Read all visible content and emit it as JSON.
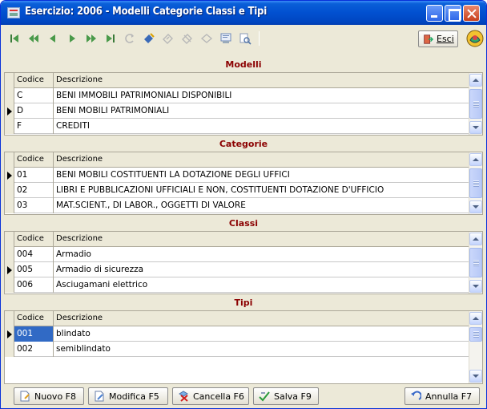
{
  "window": {
    "title": "Esercizio: 2006 - Modelli Categorie Classi e Tipi"
  },
  "toolbar": {
    "esci_label": "Esci"
  },
  "sections": {
    "modelli": {
      "title": "Modelli",
      "columns": [
        "Codice",
        "Descrizione"
      ],
      "rows": [
        {
          "code": "C",
          "desc": "BENI IMMOBILI PATRIMONIALI DISPONIBILI"
        },
        {
          "code": "D",
          "desc": "BENI MOBILI PATRIMONIALI"
        },
        {
          "code": "F",
          "desc": "CREDITI"
        }
      ]
    },
    "categorie": {
      "title": "Categorie",
      "columns": [
        "Codice",
        "Descrizione"
      ],
      "rows": [
        {
          "code": "01",
          "desc": "BENI MOBILI COSTITUENTI LA DOTAZIONE DEGLI UFFICI"
        },
        {
          "code": "02",
          "desc": "LIBRI E PUBBLICAZIONI UFFICIALI E NON, COSTITUENTI DOTAZIONE D'UFFICIO"
        },
        {
          "code": "03",
          "desc": "MAT.SCIENT., DI LABOR., OGGETTI DI VALORE"
        }
      ]
    },
    "classi": {
      "title": "Classi",
      "columns": [
        "Codice",
        "Descrizione"
      ],
      "rows": [
        {
          "code": "004",
          "desc": "Armadio"
        },
        {
          "code": "005",
          "desc": "Armadio di sicurezza"
        },
        {
          "code": "006",
          "desc": "Asciugamani elettrico"
        }
      ]
    },
    "tipi": {
      "title": "Tipi",
      "columns": [
        "Codice",
        "Descrizione"
      ],
      "rows": [
        {
          "code": "001",
          "desc": "blindato"
        },
        {
          "code": "002",
          "desc": "semiblindato"
        }
      ]
    }
  },
  "actions": {
    "nuovo": "Nuovo F8",
    "modifica": "Modifica F5",
    "cancella": "Cancella F6",
    "salva": "Salva F9",
    "annulla": "Annulla F7"
  },
  "colors": {
    "section_title": "#8b0000",
    "selection": "#316ac5",
    "titlebar": "#0150d0"
  }
}
